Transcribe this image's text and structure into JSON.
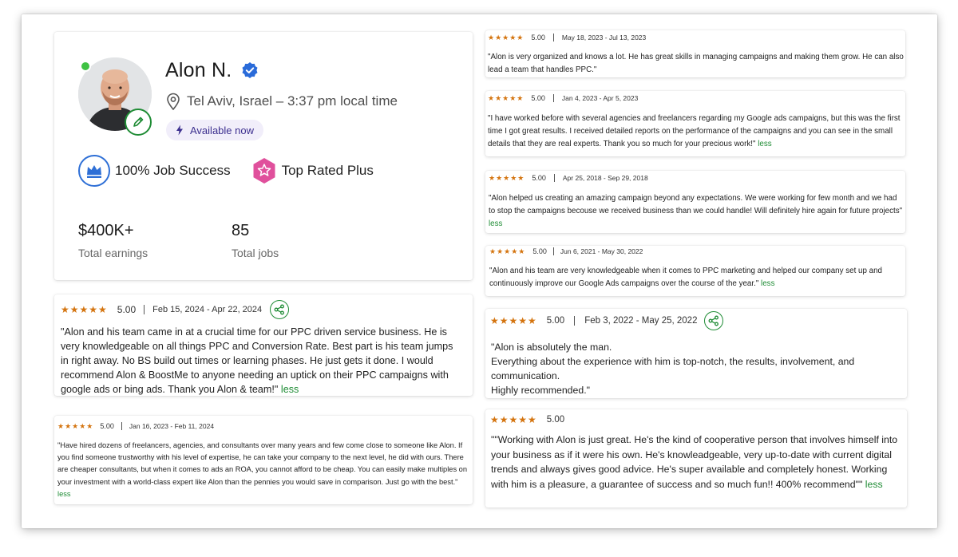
{
  "profile": {
    "name": "Alon N.",
    "location": "Tel Aviv, Israel – 3:37 pm local time",
    "availability": "Available now",
    "job_success": "100% Job Success",
    "top_rated": "Top Rated Plus",
    "earnings_value": "$400K+",
    "earnings_label": "Total earnings",
    "jobs_value": "85",
    "jobs_label": "Total jobs"
  },
  "stars": "★★★★★",
  "less_label": "less",
  "colors": {
    "star": "#d4740f",
    "accent_green": "#1f8c35",
    "verified_blue": "#2a6bd9",
    "badge_pink": "#e0509c",
    "badge_blue": "#2e6fd6"
  },
  "reviews": [
    {
      "score": "5.00",
      "dates": "Feb 15, 2024 - Apr 22, 2024",
      "text": "\"Alon and his team came in at a crucial time for our PPC driven service business. He is very knowledgeable on all things PPC and Conversion Rate. Best part is his team jumps in right away. No BS build out times or learning phases. He just gets it done. I would recommend Alon & BoostMe to anyone needing an uptick on their PPC campaigns with google ads or bing ads. Thank you Alon & team!\""
    },
    {
      "score": "5.00",
      "dates": "Jan 16, 2023 - Feb 11, 2024",
      "text": "\"Have hired dozens of freelancers, agencies, and consultants over many years and few come close to someone like Alon. If you find someone trustworthy with his level of expertise, he can take your company to the next level, he did with ours. There are cheaper consultants, but when it comes to ads an ROA, you cannot afford to be cheap. You can easily make multiples on your investment with a world-class expert like Alon than the pennies you would save in comparison. Just go with the best.\""
    },
    {
      "score": "5.00",
      "dates": "May 18, 2023 - Jul 13, 2023",
      "text": "\"Alon is very organized and knows a lot. He has great skills in managing campaigns and making them grow. He can also lead a team that handles PPC.\""
    },
    {
      "score": "5.00",
      "dates": "Jan 4, 2023 - Apr 5, 2023",
      "text": "\"I have worked before with several agencies and freelancers regarding my Google ads campaigns, but this was the first time I got great results. I received detailed reports on the performance of the campaigns and you can see in the small details that they are real experts. Thank you so much for your precious work!\""
    },
    {
      "score": "5.00",
      "dates": "Apr 25, 2018 - Sep 29, 2018",
      "text": "\"Alon helped us creating an amazing campaign beyond any expectations. We were working for few month and we had to stop the campaigns becouse we received business than we could handle! Will definitely hire again for future projects\""
    },
    {
      "score": "5.00",
      "dates": "Jun 6, 2021 - May 30, 2022",
      "text": "\"Alon and his team are very knowledgeable when it comes to PPC marketing and helped our company set up and continuously improve our Google Ads campaigns over the course of the year.\""
    },
    {
      "score": "5.00",
      "dates": "Feb 3, 2022 - May 25, 2022",
      "line1": "\"Alon is absolutely the man.",
      "line2": "Everything about the experience with him is top-notch, the results, involvement, and communication.",
      "line3": "Highly recommended.\""
    },
    {
      "score": "5.00",
      "text": "\"\"Working with Alon is just great. He's the kind of cooperative person that involves himself into your business as if it were his own. He's knowleadgeable, very up-to-date with current digital trends and always gives good advice. He's super available and completely honest. Working with him is a pleasure, a guarantee of success and so much fun!! 400% recommend\"\""
    }
  ]
}
